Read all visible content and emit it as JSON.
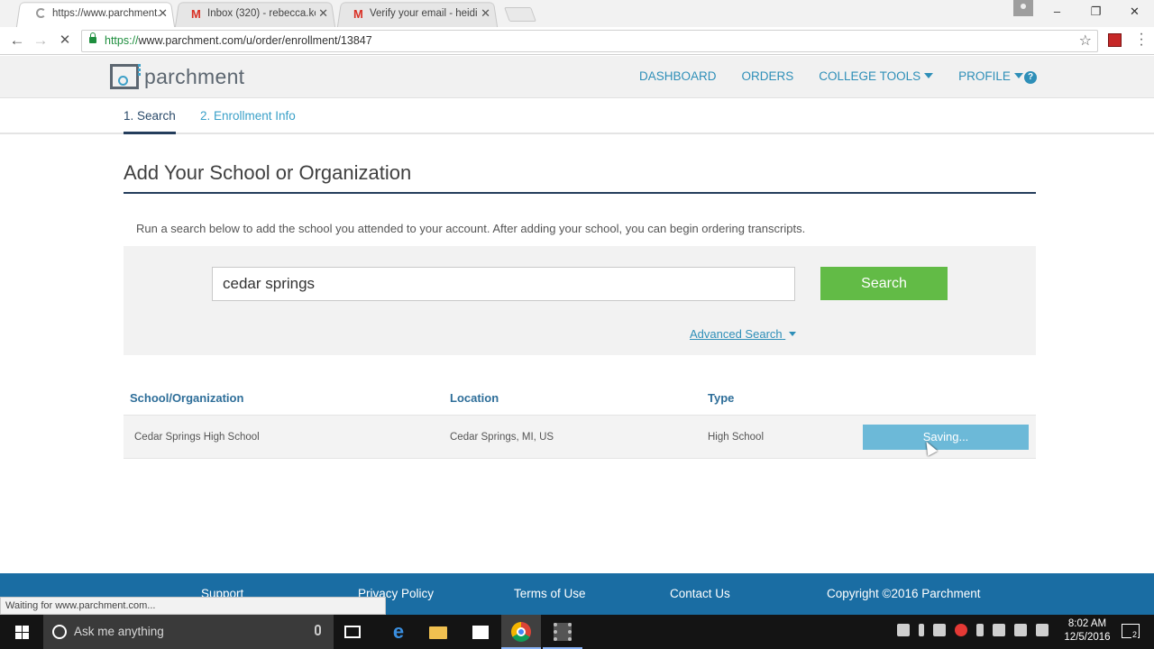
{
  "browser": {
    "tabs": [
      {
        "title": "https://www.parchment.c",
        "active": true
      },
      {
        "title": "Inbox (320) - rebecca.ko",
        "active": false
      },
      {
        "title": "Verify your email - heidi",
        "active": false
      }
    ],
    "url_scheme": "https://",
    "url_rest": "www.parchment.com/u/order/enrollment/13847",
    "window_controls": {
      "minimize": "–",
      "restore": "❐",
      "close": "✕"
    },
    "status_text": "Waiting for www.parchment.com..."
  },
  "site": {
    "logo_text": "parchment",
    "nav": {
      "dashboard": "DASHBOARD",
      "orders": "ORDERS",
      "college_tools": "COLLEGE TOOLS",
      "profile": "PROFILE",
      "help": "?"
    },
    "steps": {
      "step1": "1. Search",
      "step2": "2. Enrollment Info"
    },
    "title": "Add Your School or Organization",
    "intro": "Run a search below to add the school you attended to your account. After adding your school, you can begin ordering transcripts.",
    "search": {
      "value": "cedar springs",
      "button": "Search",
      "advanced": "Advanced Search"
    },
    "results": {
      "headers": {
        "school": "School/Organization",
        "location": "Location",
        "type": "Type"
      },
      "rows": [
        {
          "school": "Cedar Springs High School",
          "location": "Cedar Springs, MI, US",
          "type": "High School",
          "action": "Saving..."
        }
      ]
    },
    "footer": {
      "support": "Support",
      "privacy": "Privacy Policy",
      "terms": "Terms of Use",
      "contact": "Contact Us",
      "copyright": "Copyright ©2016 Parchment"
    },
    "colors": {
      "brand_blue": "#2e8fb8",
      "search_green": "#62bb46",
      "footer_blue": "#1a6da3",
      "saving_blue": "#6cb9d8"
    }
  },
  "taskbar": {
    "search_placeholder": "Ask me anything",
    "time": "8:02 AM",
    "date": "12/5/2016",
    "notification_count": "2"
  }
}
